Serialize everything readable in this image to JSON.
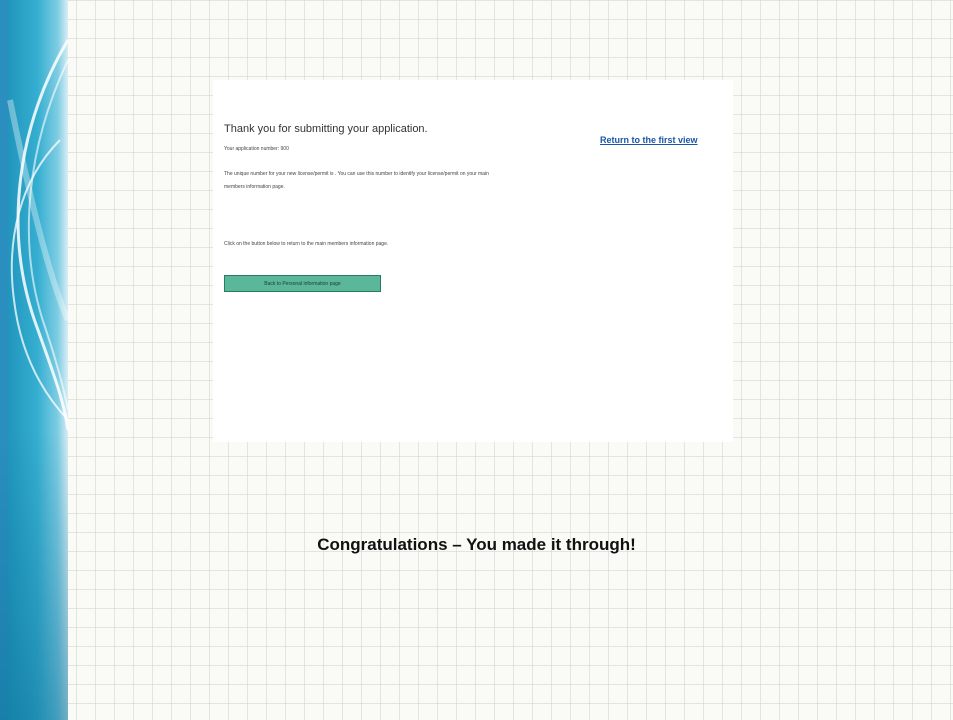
{
  "colors": {
    "band": "#2ea6cc",
    "button": "#5ab79a",
    "link": "#1a56a8"
  },
  "screenshot": {
    "title": "Thank you for submitting your application.",
    "app_number": "Your application number: 900",
    "info_text": "The unique number for your new license/permit is . You can use this number to identify your license/permit on your main members information page.",
    "instruction_text": "Click on the button below to return to the main members information page.",
    "back_button_label": "Back to Personal information page",
    "return_link": "Return to the first view"
  },
  "caption": "Congratulations – You made it through!"
}
